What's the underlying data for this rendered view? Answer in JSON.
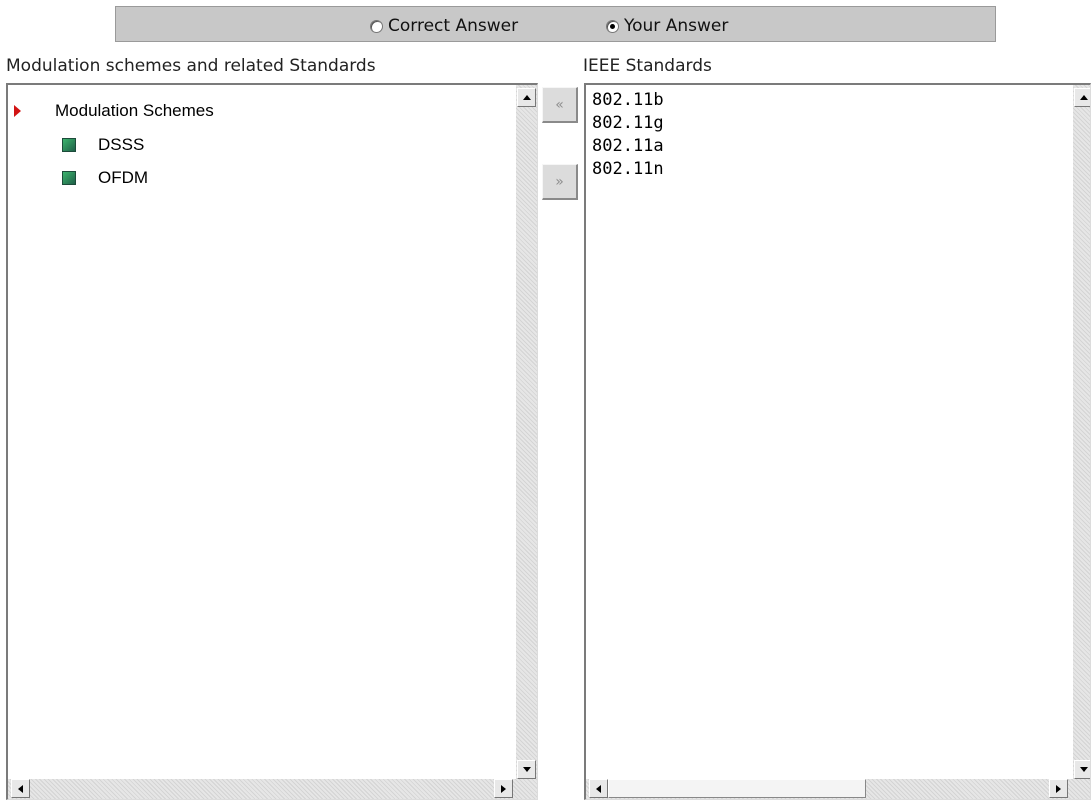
{
  "answer_toggle": {
    "correct_label": "Correct Answer",
    "yours_label": "Your Answer",
    "selected": "Your Answer"
  },
  "left_panel": {
    "heading": "Modulation schemes and related Standards",
    "root": {
      "label": "Modulation Schemes",
      "expanded": true,
      "children": [
        {
          "label": "DSSS"
        },
        {
          "label": "OFDM"
        }
      ]
    }
  },
  "right_panel": {
    "heading": "IEEE Standards",
    "items": [
      "802.11b",
      "802.11g",
      "802.11a",
      "802.11n"
    ]
  },
  "transfer_buttons": {
    "move_left_glyph": "«",
    "move_right_glyph": "»"
  },
  "colors": {
    "toggle_bar": "#c8c8c8",
    "expander_arrow": "#d21313",
    "node_icon": "#2f8f5c"
  }
}
